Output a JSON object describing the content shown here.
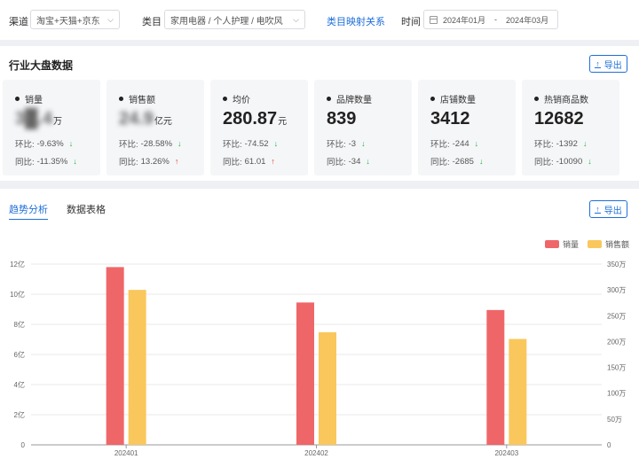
{
  "filters": {
    "channel_label": "渠道",
    "channel_value": "淘宝+天猫+京东",
    "category_label": "类目",
    "category_value": "家用电器 / 个人护理 / 电吹风",
    "mapping_link": "类目映射关系",
    "time_label": "时间",
    "date_start": "2024年01月",
    "date_sep": "-",
    "date_end": "2024年03月"
  },
  "overview": {
    "title": "行业大盘数据",
    "export_label": "导出",
    "cards": [
      {
        "title": "销量",
        "value": "3█.4",
        "unit": "万",
        "hb_label": "环比:",
        "hb": "-9.63%",
        "hb_dir": "down",
        "tb_label": "同比:",
        "tb": "-11.35%",
        "tb_dir": "down"
      },
      {
        "title": "销售额",
        "value": "24.9",
        "unit": "亿元",
        "hb_label": "环比:",
        "hb": "-28.58%",
        "hb_dir": "down",
        "tb_label": "同比:",
        "tb": "13.26%",
        "tb_dir": "up"
      },
      {
        "title": "均价",
        "value": "280.87",
        "unit": "元",
        "hb_label": "环比:",
        "hb": "-74.52",
        "hb_dir": "down",
        "tb_label": "同比:",
        "tb": "61.01",
        "tb_dir": "up"
      },
      {
        "title": "品牌数量",
        "value": "839",
        "unit": "",
        "hb_label": "环比:",
        "hb": "-3",
        "hb_dir": "down",
        "tb_label": "同比:",
        "tb": "-34",
        "tb_dir": "down"
      },
      {
        "title": "店铺数量",
        "value": "3412",
        "unit": "",
        "hb_label": "环比:",
        "hb": "-244",
        "hb_dir": "down",
        "tb_label": "同比:",
        "tb": "-2685",
        "tb_dir": "down"
      },
      {
        "title": "热销商品数",
        "value": "12682",
        "unit": "",
        "hb_label": "环比:",
        "hb": "-1392",
        "hb_dir": "down",
        "tb_label": "同比:",
        "tb": "-10090",
        "tb_dir": "down"
      }
    ]
  },
  "trend": {
    "tabs": [
      "趋势分析",
      "数据表格"
    ],
    "export_label": "导出"
  },
  "icons": {
    "arrow_down": "↓",
    "arrow_up": "↑",
    "export": "export-icon",
    "calendar": "calendar-icon",
    "chevron": "chevron-down-icon"
  },
  "colors": {
    "accent": "#1e6fd9",
    "sales_volume": "#ef6669",
    "sales_amount": "#f9c75c",
    "down": "#22b14c",
    "up": "#e23b3b"
  },
  "chart_data": {
    "type": "bar",
    "categories": [
      "202401",
      "202402",
      "202403"
    ],
    "series": [
      {
        "name": "销量",
        "values": [
          11.8,
          9.45,
          8.95
        ],
        "axis": "left"
      },
      {
        "name": "销售额",
        "values": [
          300,
          218,
          205
        ],
        "axis": "right"
      }
    ],
    "y_left": {
      "ticks": [
        "0",
        "2亿",
        "4亿",
        "6亿",
        "8亿",
        "10亿",
        "12亿"
      ],
      "ylim": [
        0,
        12
      ]
    },
    "y_right": {
      "ticks": [
        "0",
        "50万",
        "100万",
        "150万",
        "200万",
        "250万",
        "300万",
        "350万"
      ],
      "ylim": [
        0,
        350
      ]
    },
    "legend_position": "top-right",
    "grid": true
  }
}
